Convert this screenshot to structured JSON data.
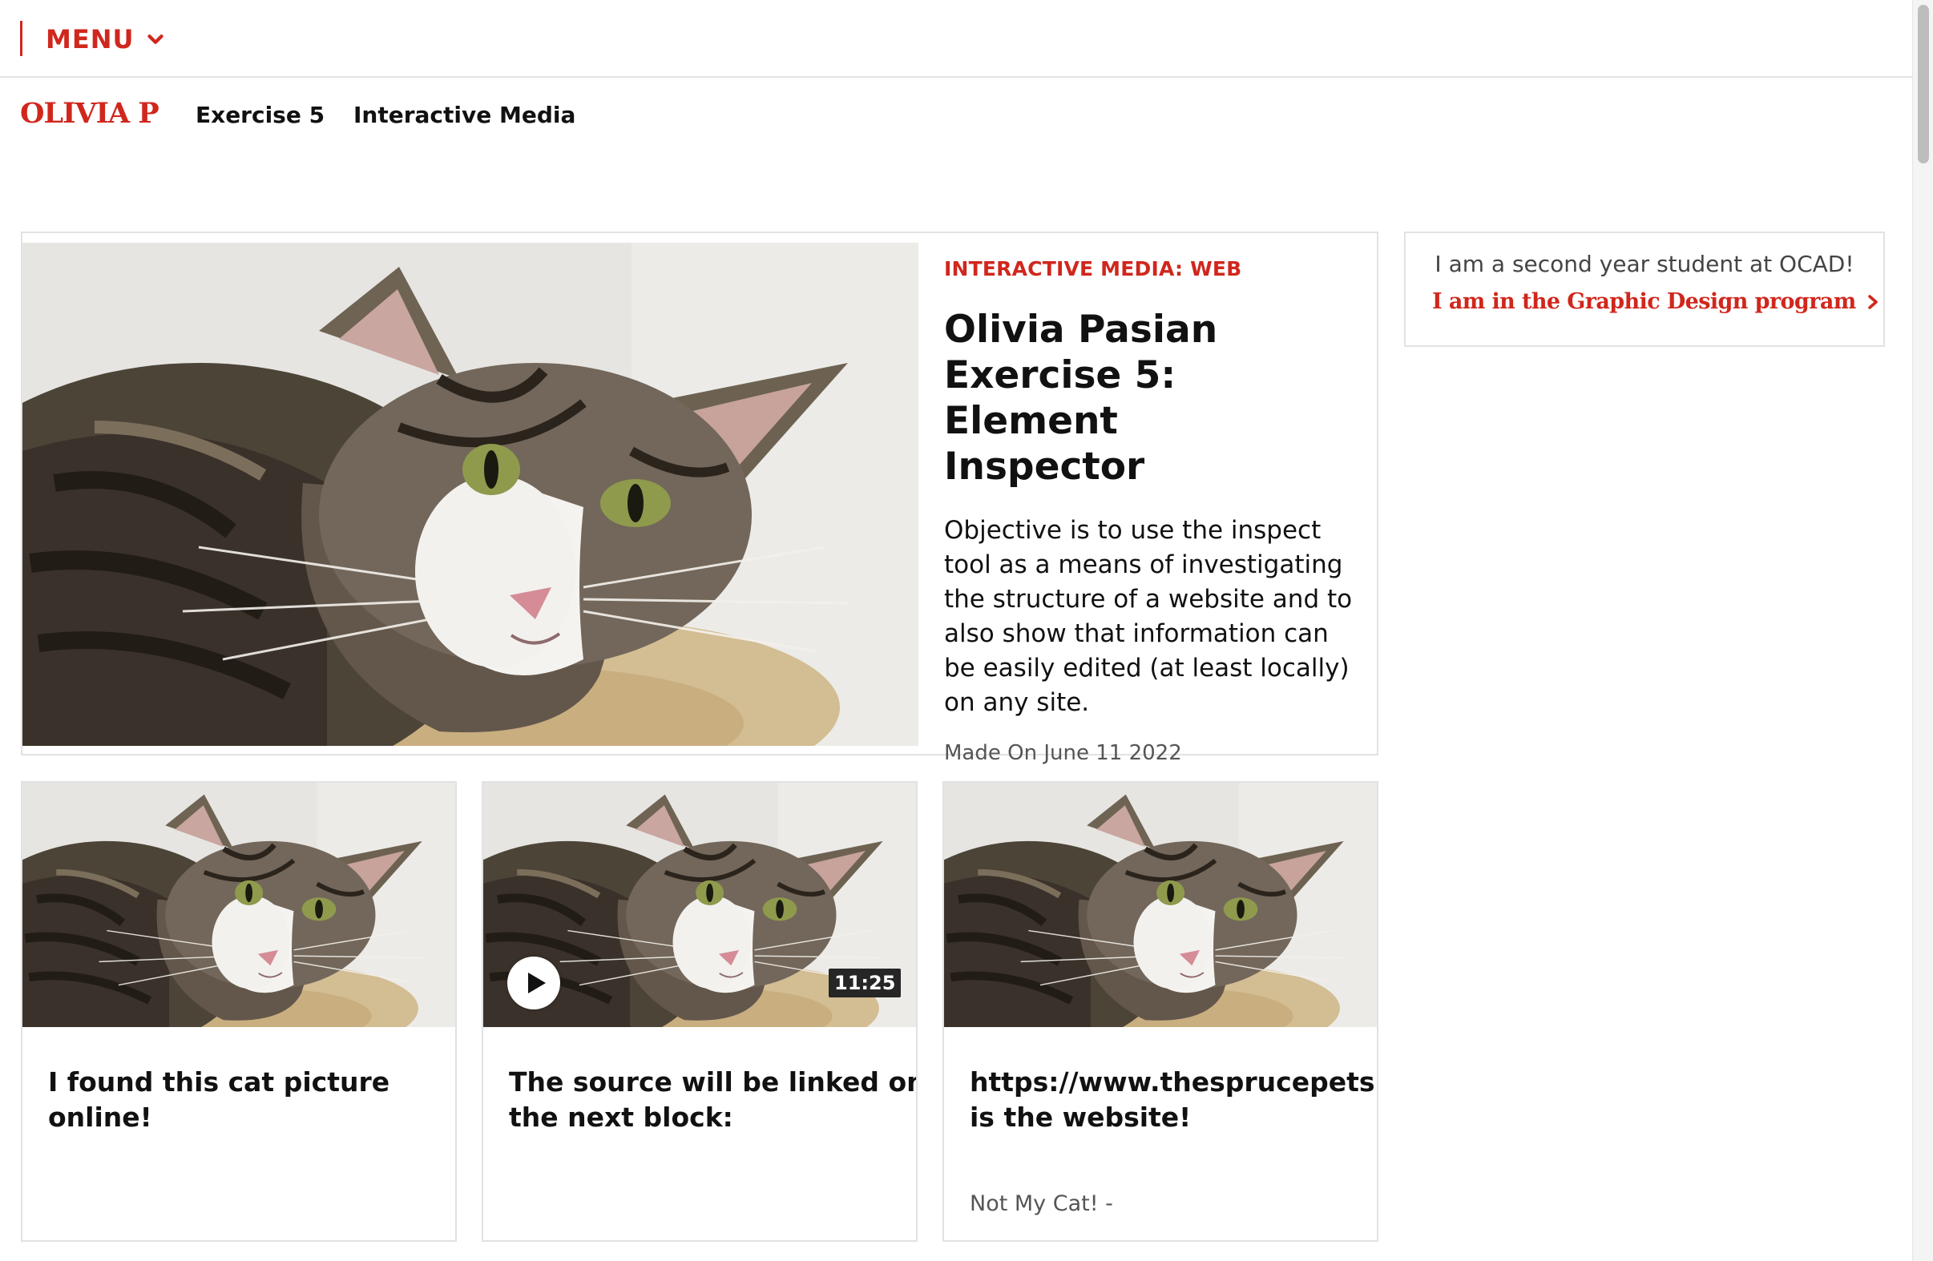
{
  "menubar": {
    "menu_label": "MENU",
    "chevron_icon": "chevron-down-icon"
  },
  "sitenav": {
    "brand": "OLIVIA P",
    "links": [
      "Exercise 5",
      "Interactive Media"
    ]
  },
  "feature": {
    "kicker": "INTERACTIVE MEDIA: WEB",
    "title_line1": "Olivia Pasian",
    "title_line2": "Exercise 5: Element",
    "title_line3": "Inspector",
    "description": "Objective is to use the inspect tool as a means of investigating the structure of a website and to also show that information can be easily edited (at least locally) on any site.",
    "meta": "Made On June 11 2022",
    "image": "tabby-cat-photo"
  },
  "cards": [
    {
      "title_line1": "I found this cat picture",
      "title_line2": "online!",
      "image": "tabby-cat-photo"
    },
    {
      "title_line1": "The source will be linked on",
      "title_line2": "the next block:",
      "image": "tabby-cat-photo",
      "duration": "11:25",
      "play_icon": "play-icon"
    },
    {
      "title_line1": "https://www.thesprucepets.com",
      "title_line2": "is the website!",
      "image": "tabby-cat-photo",
      "footer": "Not My Cat!  -"
    }
  ],
  "bio": {
    "line1": "I am a second year student at OCAD!",
    "link": "I am in the Graphic Design program",
    "link_icon": "chevron-right-icon"
  },
  "colors": {
    "accent": "#d0271d",
    "border": "#e2e2e2",
    "text": "#111111",
    "muted": "#555555"
  }
}
